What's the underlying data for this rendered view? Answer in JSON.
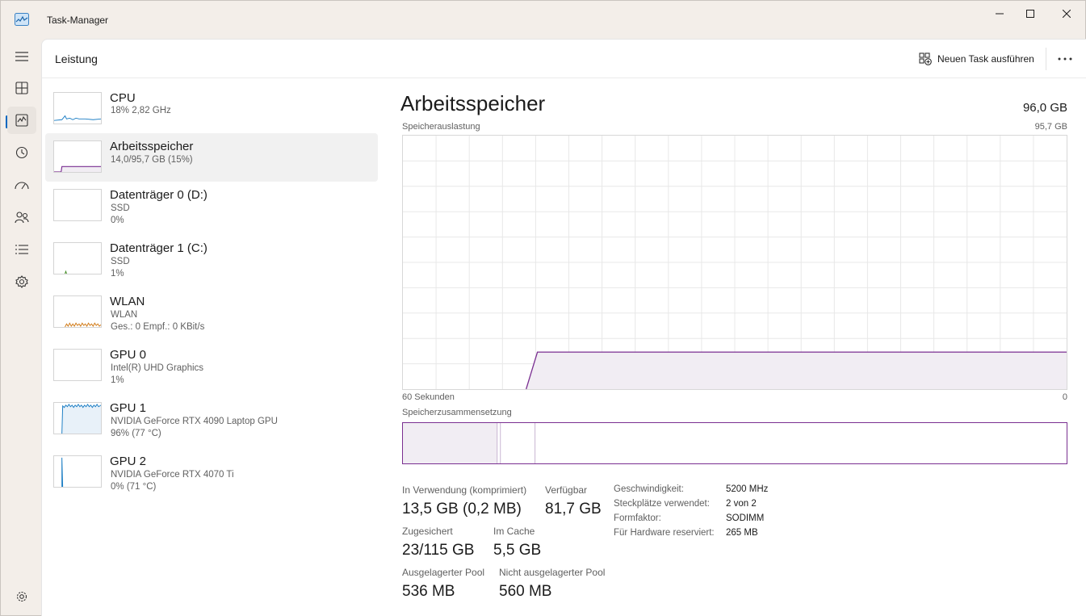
{
  "window": {
    "title": "Task-Manager"
  },
  "header": {
    "title": "Leistung",
    "run_task_label": "Neuen Task ausführen"
  },
  "nav": {
    "items": [
      "menu-icon",
      "processes-icon",
      "performance-icon",
      "app-history-icon",
      "startup-apps-icon",
      "users-icon",
      "details-icon",
      "services-icon",
      "settings-icon"
    ],
    "active": "performance-icon"
  },
  "devices": [
    {
      "name": "CPU",
      "line1": "18%  2,82 GHz",
      "line2": ""
    },
    {
      "name": "Arbeitsspeicher",
      "line1": "14,0/95,7 GB (15%)",
      "line2": ""
    },
    {
      "name": "Datenträger 0 (D:)",
      "line1": "SSD",
      "line2": "0%"
    },
    {
      "name": "Datenträger 1 (C:)",
      "line1": "SSD",
      "line2": "1%"
    },
    {
      "name": "WLAN",
      "line1": "WLAN",
      "line2": "Ges.: 0  Empf.: 0 KBit/s"
    },
    {
      "name": "GPU 0",
      "line1": "Intel(R) UHD Graphics",
      "line2": "1%"
    },
    {
      "name": "GPU 1",
      "line1": "NVIDIA GeForce RTX 4090 Laptop GPU",
      "line2": "96%  (77 °C)"
    },
    {
      "name": "GPU 2",
      "line1": "NVIDIA GeForce RTX 4070 Ti",
      "line2": "0%  (71 °C)"
    }
  ],
  "detail": {
    "title": "Arbeitsspeicher",
    "total": "96,0 GB",
    "usage_label": "Speicherauslastung",
    "usage_max": "95,7 GB",
    "time_left": "60 Sekunden",
    "time_right": "0",
    "composition_label": "Speicherzusammensetzung",
    "usage_fraction": 0.146,
    "stats": {
      "in_use_label": "In Verwendung (komprimiert)",
      "in_use_value": "13,5 GB (0,2 MB)",
      "available_label": "Verfügbar",
      "available_value": "81,7 GB",
      "committed_label": "Zugesichert",
      "committed_value": "23/115 GB",
      "cached_label": "Im Cache",
      "cached_value": "5,5 GB",
      "paged_label": "Ausgelagerter Pool",
      "paged_value": "536 MB",
      "nonpaged_label": "Nicht ausgelagerter Pool",
      "nonpaged_value": "560 MB"
    },
    "specs": {
      "speed_label": "Geschwindigkeit:",
      "speed_value": "5200 MHz",
      "slots_label": "Steckplätze verwendet:",
      "slots_value": "2 von 2",
      "form_label": "Formfaktor:",
      "form_value": "SODIMM",
      "reserved_label": "Für Hardware reserviert:",
      "reserved_value": "265 MB"
    }
  },
  "colors": {
    "memory": "#7a2f91",
    "memory_fill": "#f1edf3",
    "cpu": "#1a7dc4",
    "wlan": "#d17a16",
    "gpu": "#1a7dc4",
    "accent": "#0067c0"
  }
}
